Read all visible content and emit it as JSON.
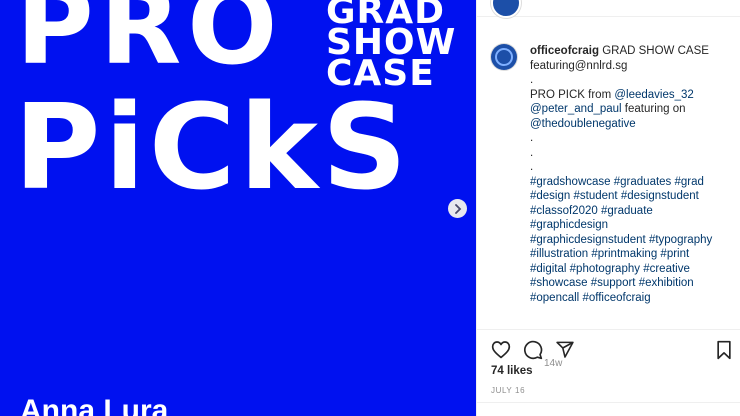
{
  "post": {
    "headline_1": "PRO",
    "headline_2": "PiCkS",
    "grad_lines": [
      "GRAD",
      "SHOW",
      "CASE"
    ],
    "person_name": "Anna Lura",
    "next_icon": "chevron-right-icon"
  },
  "caption": {
    "username": "officeofcraig",
    "line1_text": "GRAD SHOW CASE",
    "line2": "featuring@nnlrd.sg",
    "dot": ".",
    "propick_prefix": "PRO PICK from ",
    "mention1": "@leedavies_32",
    "mention2": "@peter_and_paul",
    "featuring_on": " featuring on",
    "mention3": "@thedoublenegative",
    "hashtag_lines": [
      [
        "#gradshowcase",
        "#graduates",
        "#grad"
      ],
      [
        "#design",
        "#student",
        "#designstudent"
      ],
      [
        "#classof2020",
        "#graduate"
      ],
      [
        "#graphicdesign"
      ],
      [
        "#graphicdesignstudent",
        "#typography"
      ],
      [
        "#illustration",
        "#printmaking",
        "#print"
      ],
      [
        "#digital",
        "#photography",
        "#creative"
      ],
      [
        "#showcase",
        "#support",
        "#exhibition"
      ],
      [
        "#opencall",
        "#officeofcraig"
      ]
    ],
    "time": "14w"
  },
  "actions": {
    "like_icon": "heart-icon",
    "comment_icon": "comment-icon",
    "share_icon": "share-icon",
    "save_icon": "bookmark-icon"
  },
  "likes": "74 likes",
  "date": "JULY 16",
  "colors": {
    "post_bg": "#0011f0",
    "link": "#00376b",
    "muted": "#8e8e8e"
  }
}
